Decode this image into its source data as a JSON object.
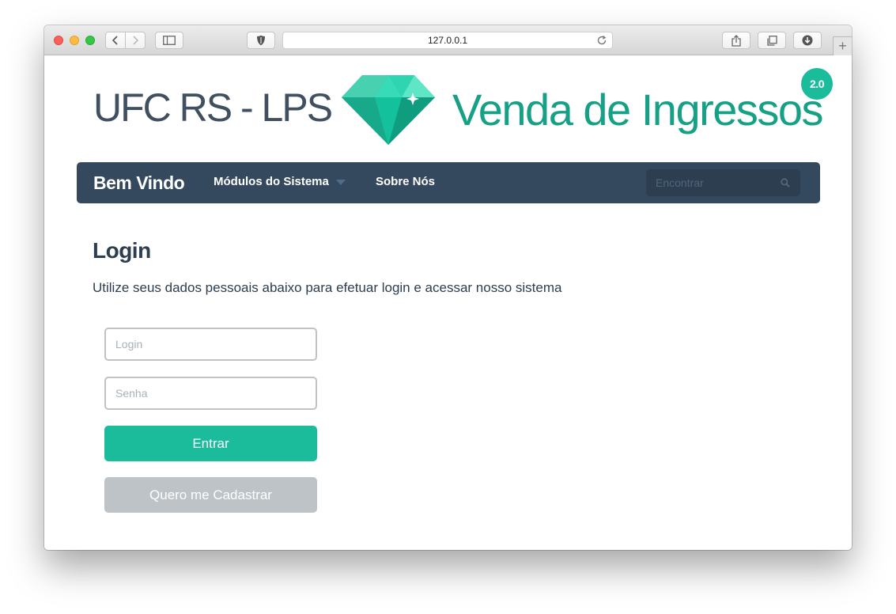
{
  "browser": {
    "url": "127.0.0.1",
    "new_tab_label": "+"
  },
  "banner": {
    "left_text": "UFC RS - LPS",
    "right_text": "Venda de Ingressos",
    "version": "2.0",
    "logo_icon": "diamond-icon"
  },
  "navbar": {
    "brand": "Bem Vindo",
    "modules_label": "Módulos do Sistema",
    "about_label": "Sobre Nós",
    "search_placeholder": "Encontrar"
  },
  "login": {
    "title": "Login",
    "subtitle": "Utilize seus dados pessoais abaixo para efetuar login e acessar nosso sistema",
    "login_placeholder": "Login",
    "password_placeholder": "Senha",
    "submit_label": "Entrar",
    "register_label": "Quero me Cadastrar"
  },
  "colors": {
    "accent": "#1abc9c",
    "accent_dark": "#16a085",
    "navbar": "#34495e",
    "secondary_button": "#bdc3c7"
  }
}
